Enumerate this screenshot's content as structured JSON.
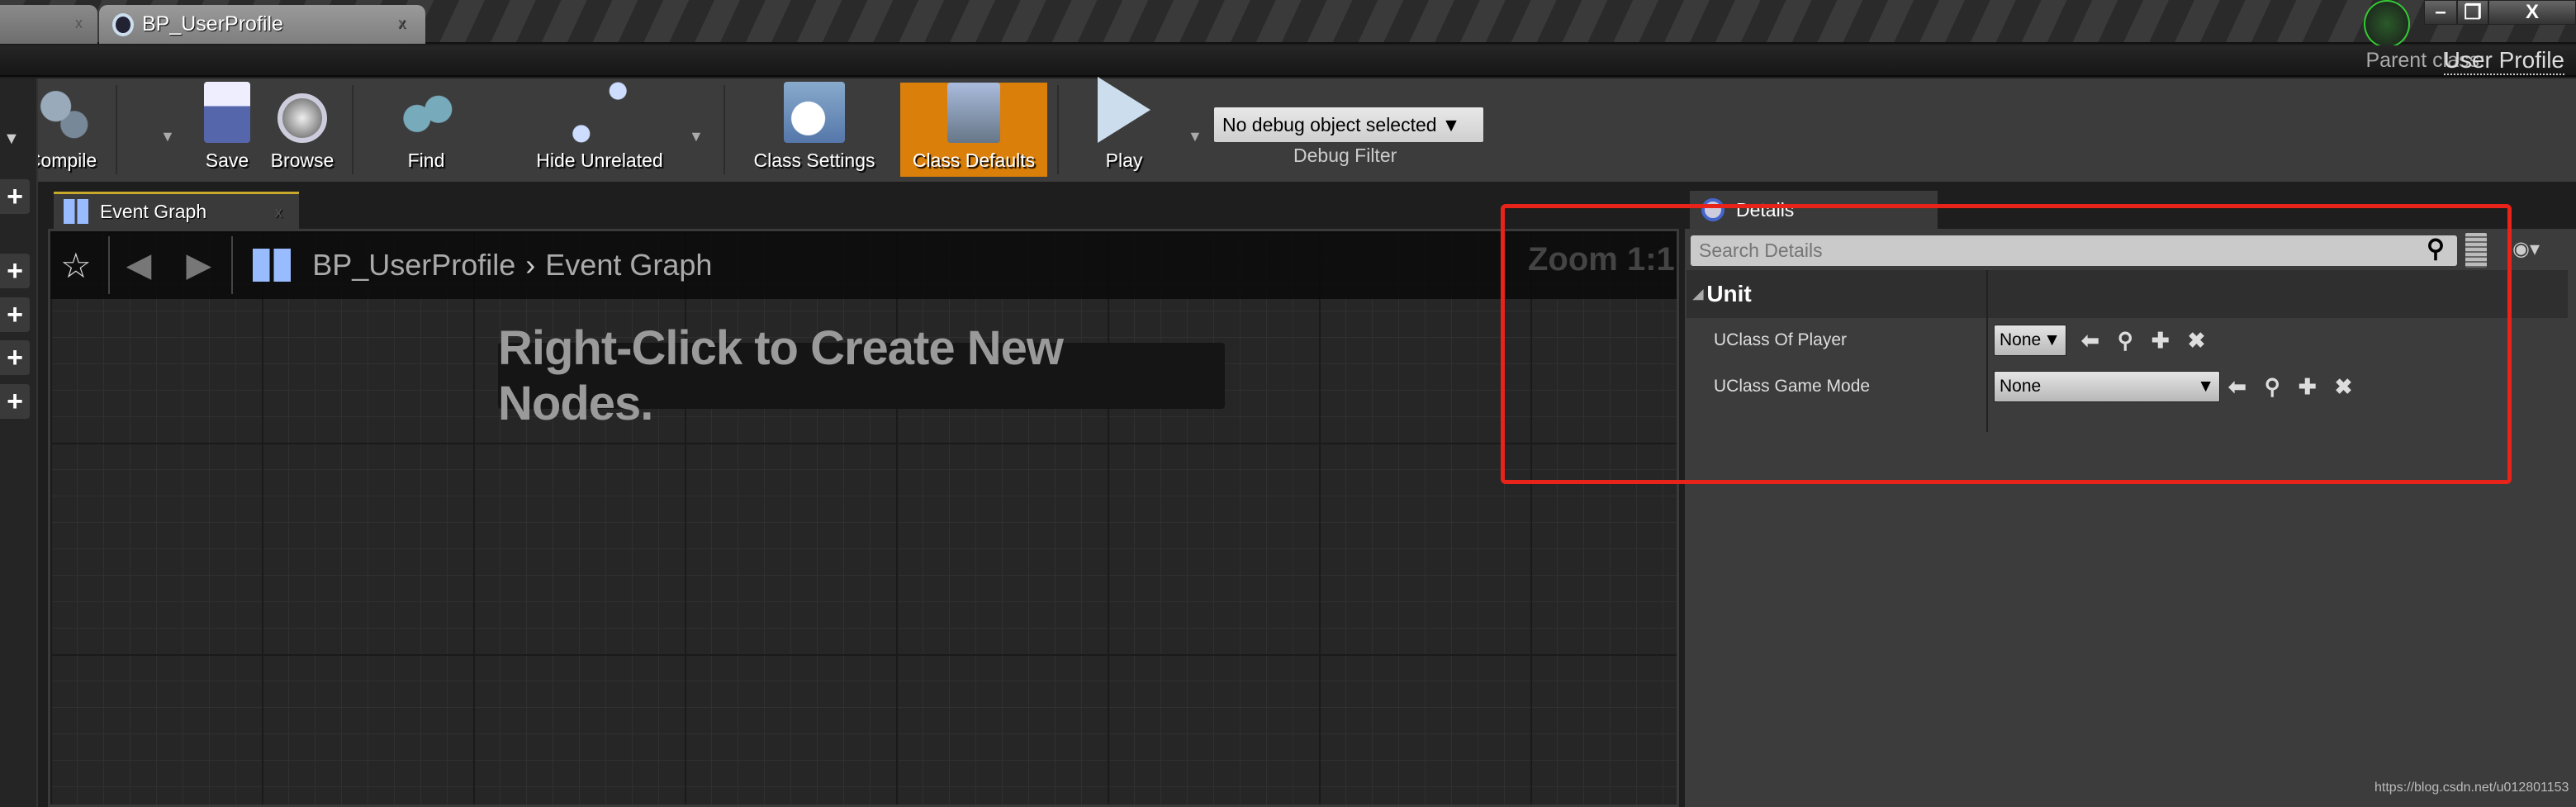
{
  "window": {
    "tab_title": "BP_UserProfile",
    "close_glyph": "x",
    "minimize": "–",
    "restore": "❐",
    "close": "X",
    "parent_class_label": "Parent class:",
    "parent_class_value": "User Profile"
  },
  "toolbar": {
    "compile": "Compile",
    "save": "Save",
    "browse": "Browse",
    "find": "Find",
    "hide_unrelated": "Hide Unrelated",
    "class_settings": "Class Settings",
    "class_defaults": "Class Defaults",
    "play": "Play",
    "debug_selected": "No debug object selected",
    "debug_filter": "Debug Filter",
    "active_color": "#d97f0a"
  },
  "graph": {
    "tab_label": "Event Graph",
    "breadcrumb_root": "BP_UserProfile",
    "breadcrumb_sep": "›",
    "breadcrumb_leaf": "Event Graph",
    "hint": "Right-Click to Create New Nodes.",
    "zoom": "Zoom 1:1"
  },
  "details": {
    "tab_label": "Details",
    "search_placeholder": "Search Details",
    "category": "Unit",
    "properties": [
      {
        "label": "UClass Of Player",
        "value": "None"
      },
      {
        "label": "UClass Game Mode",
        "value": "None"
      }
    ]
  },
  "annotation": {
    "color": "#e8231a"
  },
  "watermark": "https://blog.csdn.net/u012801153"
}
